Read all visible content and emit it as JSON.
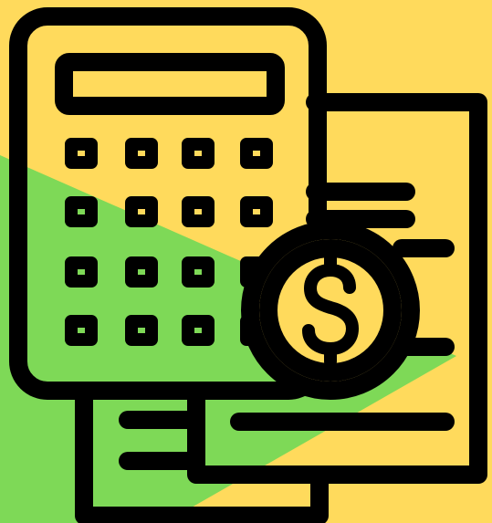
{
  "illustration": {
    "icon_name": "calculator-invoice-dollar-icon",
    "parts": [
      "background",
      "invoice-paper",
      "receipt-strip",
      "calculator",
      "dollar-coin"
    ]
  },
  "colors": {
    "background_yellow": "#FFDA5C",
    "background_green": "#7ED957",
    "outline": "#000000"
  },
  "dollar_symbol": "$"
}
